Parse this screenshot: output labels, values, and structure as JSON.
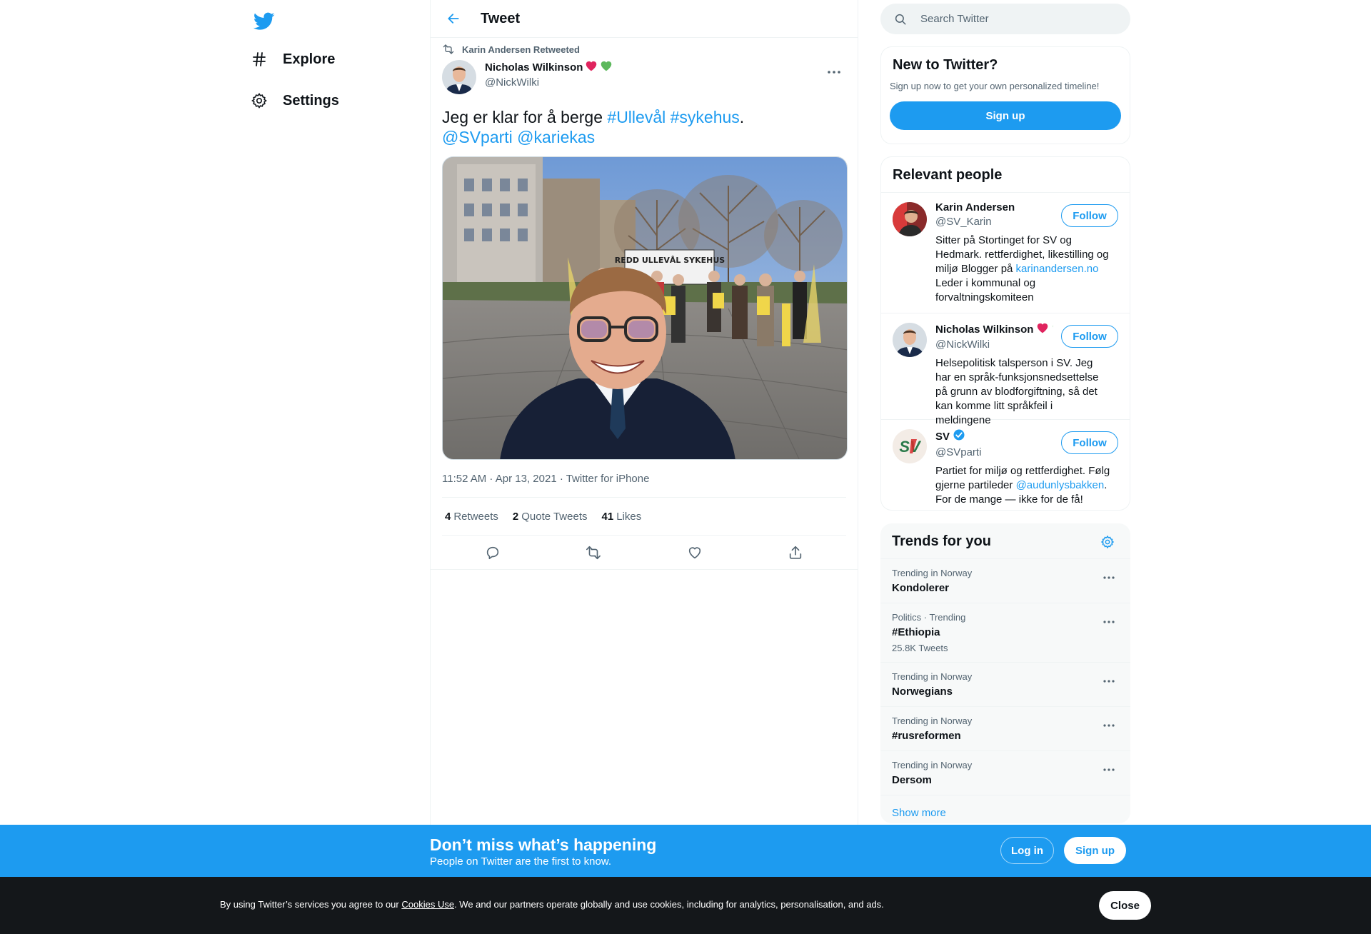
{
  "nav": {
    "explore": "Explore",
    "settings": "Settings"
  },
  "header": {
    "title": "Tweet"
  },
  "tweet": {
    "retweeted_by": "Karin Andersen Retweeted",
    "author_name": "Nicholas Wilkinson",
    "author_handle": "@NickWilki",
    "text_prefix": "Jeg er klar for å berge ",
    "hashtag1": "#Ullevål",
    "hashtag2": "#sykehus",
    "text_dot": ".",
    "mention1": "@SVparti",
    "mention2": "@kariekas",
    "sign_text": "REDD ULLEVÅL SYKEHUS",
    "meta": "11:52 AM · Apr 13, 2021 · Twitter for iPhone",
    "stats": {
      "retweets_count": "4",
      "retweets_label": "Retweets",
      "quotes_count": "2",
      "quotes_label": "Quote Tweets",
      "likes_count": "41",
      "likes_label": "Likes"
    }
  },
  "search": {
    "placeholder": "Search Twitter"
  },
  "new_to_twitter": {
    "title": "New to Twitter?",
    "subtitle": "Sign up now to get your own personalized timeline!",
    "signup": "Sign up"
  },
  "relevant_people": {
    "title": "Relevant people",
    "follow_label": "Follow",
    "people": [
      {
        "name": "Karin Andersen",
        "handle": "@SV_Karin",
        "bio_prefix": "Sitter på Stortinget for SV og Hedmark. rettferdighet, likestilling og miljø Blogger på ",
        "bio_link": "karinandersen.no",
        "bio_suffix": " Leder i kommunal og forvaltningskomiteen"
      },
      {
        "name": "Nicholas Wilkinson",
        "handle": "@NickWilki",
        "bio": "Helsepolitisk talsperson i SV. Jeg har en språk-funksjonsnedsettelse på grunn av blodforgiftning, så det kan komme litt språkfeil i meldingene"
      },
      {
        "name": "SV",
        "handle": "@SVparti",
        "avatar_text": "SV",
        "bio_prefix": "Partiet for miljø og rettferdighet. Følg gjerne partileder ",
        "bio_link": "@audunlysbakken",
        "bio_suffix": ". For de mange — ikke for de få!"
      }
    ]
  },
  "trends": {
    "title": "Trends for you",
    "items": [
      {
        "meta": "Trending in Norway",
        "name": "Kondolerer"
      },
      {
        "meta": "Politics · Trending",
        "name": "#Ethiopia",
        "count": "25.8K Tweets"
      },
      {
        "meta": "Trending in Norway",
        "name": "Norwegians"
      },
      {
        "meta": "Trending in Norway",
        "name": "#rusreformen"
      },
      {
        "meta": "Trending in Norway",
        "name": "Dersom"
      }
    ],
    "show_more": "Show more"
  },
  "bottom_bar": {
    "title": "Don’t miss what’s happening",
    "subtitle": "People on Twitter are the first to know.",
    "login": "Log in",
    "signup": "Sign up"
  },
  "cookie": {
    "prefix": "By using Twitter’s services you agree to our ",
    "link": "Cookies Use",
    "suffix": ". We and our partners operate globally and use cookies, including for analytics, personalisation, and ads.",
    "close": "Close"
  },
  "colors": {
    "brand": "#1d9bf0",
    "text": "#0f1419",
    "muted": "#536471",
    "cookie_bg": "#14171a"
  }
}
